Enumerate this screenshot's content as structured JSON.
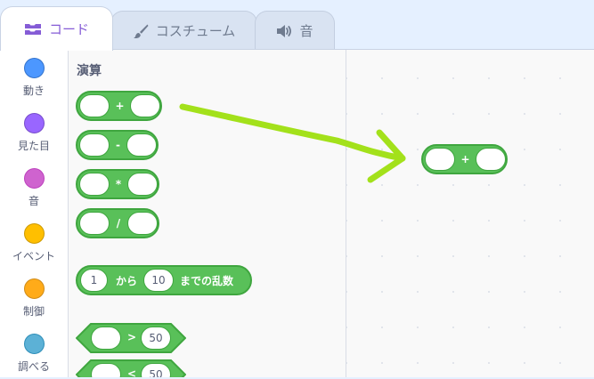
{
  "tabs": {
    "code": "コード",
    "costume": "コスチューム",
    "sound": "音"
  },
  "categories": [
    {
      "label": "動き",
      "color": "#4c97ff",
      "border": "#3373cc"
    },
    {
      "label": "見た目",
      "color": "#9966ff",
      "border": "#774dcb"
    },
    {
      "label": "音",
      "color": "#cf63cf",
      "border": "#bd42bd"
    },
    {
      "label": "イベント",
      "color": "#ffbf00",
      "border": "#cc9900"
    },
    {
      "label": "制御",
      "color": "#ffab19",
      "border": "#cf8b17"
    },
    {
      "label": "調べる",
      "color": "#5cb1d6",
      "border": "#2e8eb8"
    }
  ],
  "palette": {
    "section_title": "演算",
    "add_op": "+",
    "subtract_op": "-",
    "multiply_op": "*",
    "divide_op": "/",
    "random": {
      "from_value": "1",
      "from_label": "から",
      "to_value": "10",
      "to_label": "までの乱数"
    },
    "greater": {
      "op": ">",
      "value": "50"
    },
    "less": {
      "op": "<",
      "value": "50"
    }
  },
  "script_area": {
    "add_op": "+"
  },
  "colors": {
    "operator_block": "#59c059",
    "operator_border": "#3fa63f",
    "annotation_arrow": "#a3e11b",
    "active_tab_text": "#855cd6"
  },
  "icons": {
    "code_tab": "code-blocks-icon",
    "costume_tab": "paintbrush-icon",
    "sound_tab": "speaker-icon"
  }
}
